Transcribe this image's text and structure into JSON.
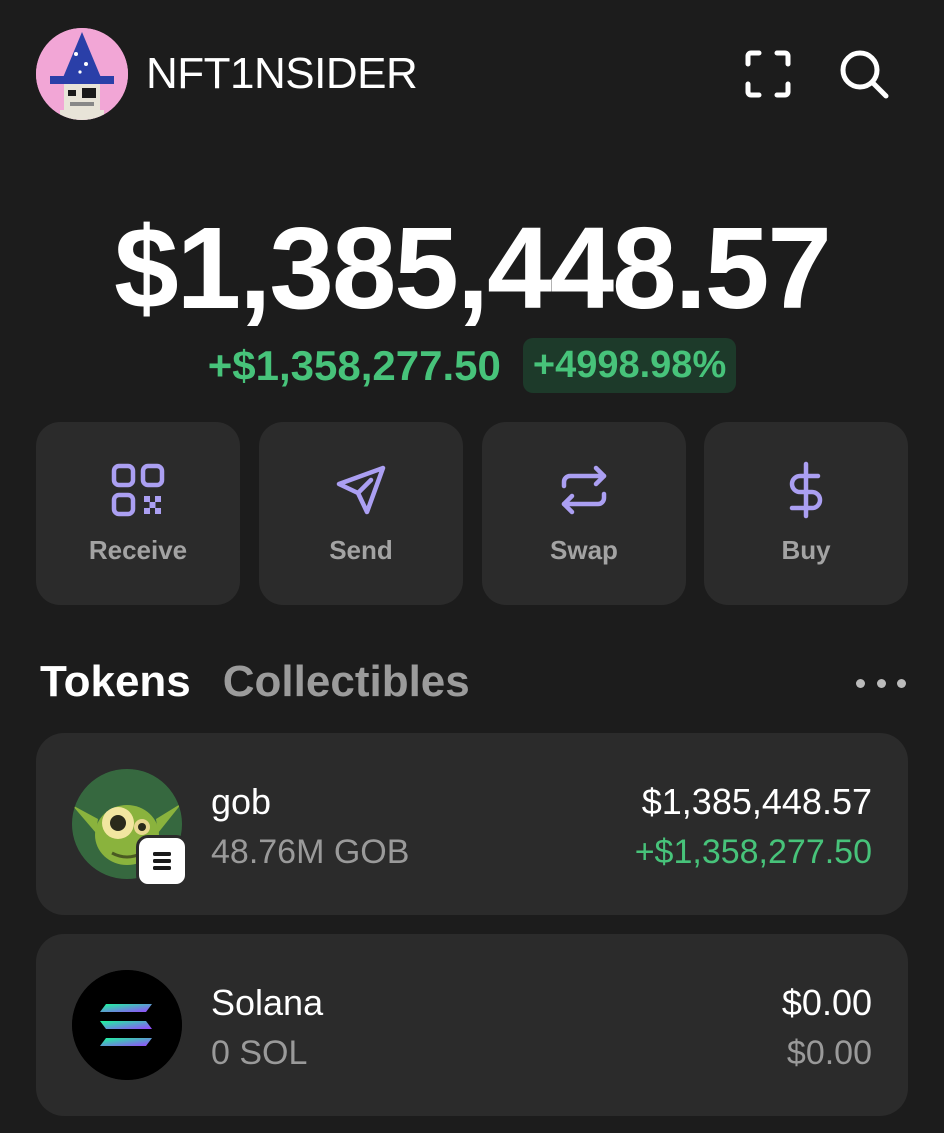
{
  "header": {
    "username": "NFT1NSIDER",
    "scan_icon": "scan-icon",
    "search_icon": "search-icon"
  },
  "portfolio": {
    "balance": "$1,385,448.57",
    "change_amount": "+$1,358,277.50",
    "change_percent": "+4998.98%"
  },
  "actions": [
    {
      "label": "Receive",
      "icon": "qr-code-icon"
    },
    {
      "label": "Send",
      "icon": "paper-plane-icon"
    },
    {
      "label": "Swap",
      "icon": "swap-arrows-icon"
    },
    {
      "label": "Buy",
      "icon": "dollar-icon"
    }
  ],
  "tabs": [
    {
      "label": "Tokens",
      "active": true
    },
    {
      "label": "Collectibles",
      "active": false
    }
  ],
  "tokens": [
    {
      "name": "gob",
      "amount": "48.76M GOB",
      "value": "$1,385,448.57",
      "change": "+$1,358,277.50",
      "change_color": "#47c37a"
    },
    {
      "name": "Solana",
      "amount": "0 SOL",
      "value": "$0.00",
      "change": "$0.00",
      "change_color": "#9a9a9a"
    }
  ],
  "colors": {
    "background": "#1c1c1c",
    "card": "#2b2b2b",
    "accent_purple": "#ab9ff2",
    "positive_green": "#47c37a"
  }
}
